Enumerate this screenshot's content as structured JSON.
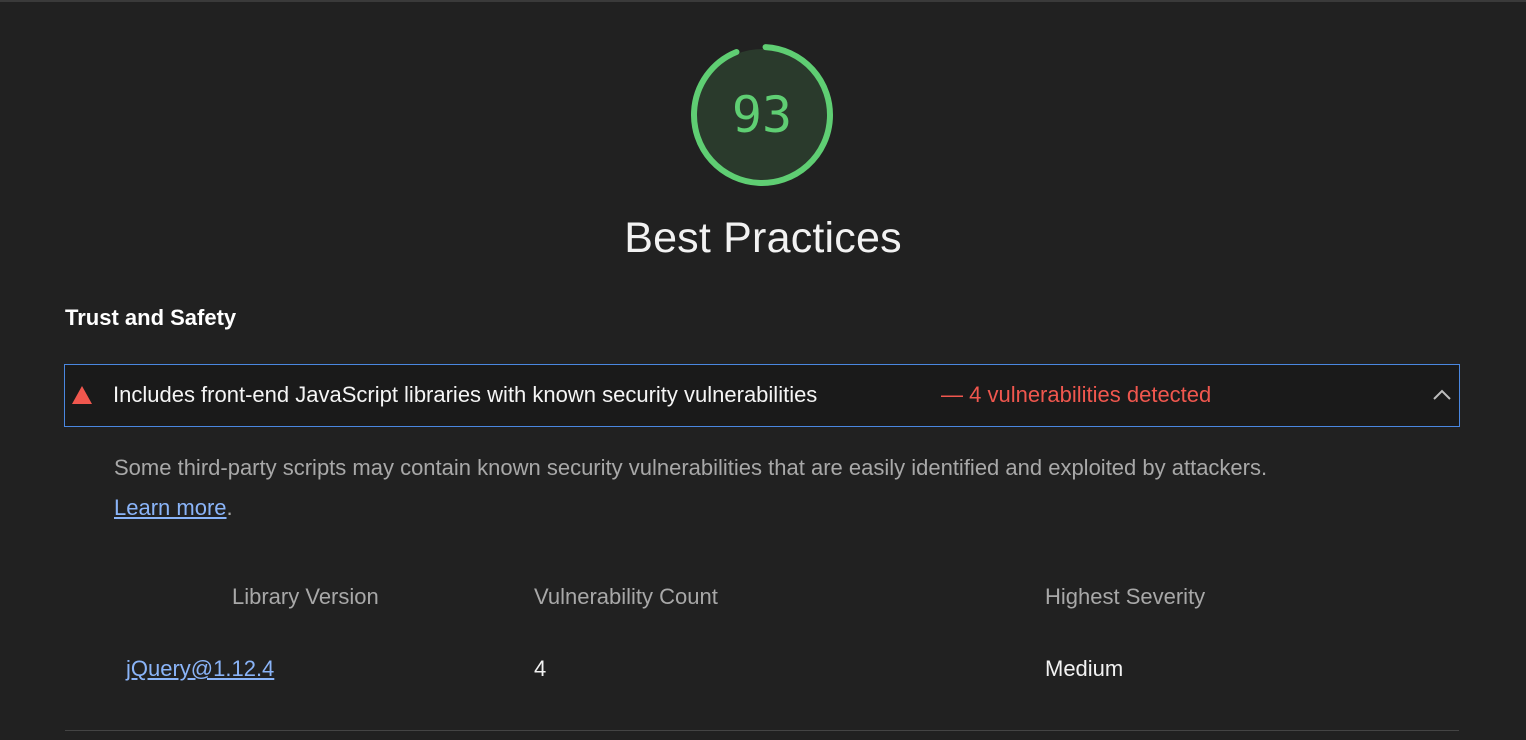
{
  "score": {
    "value": "93",
    "fraction": 0.93,
    "color": "#5fce73"
  },
  "category": {
    "title": "Best Practices"
  },
  "group": {
    "title": "Trust and Safety"
  },
  "audit": {
    "status_icon": "fail-triangle-icon",
    "status_color": "#f0574e",
    "title": "Includes front-end JavaScript libraries with known security vulnerabilities",
    "display_value": "— 4 vulnerabilities detected",
    "expanded": true,
    "description": "Some third-party scripts may contain known security vulnerabilities that are easily identified and exploited by attackers.",
    "learn_more": "Learn more",
    "learn_more_suffix": "."
  },
  "table": {
    "headers": [
      "Library Version",
      "Vulnerability Count",
      "Highest Severity"
    ],
    "rows": [
      {
        "library": "jQuery@1.12.4",
        "count": "4",
        "severity": "Medium"
      }
    ]
  }
}
